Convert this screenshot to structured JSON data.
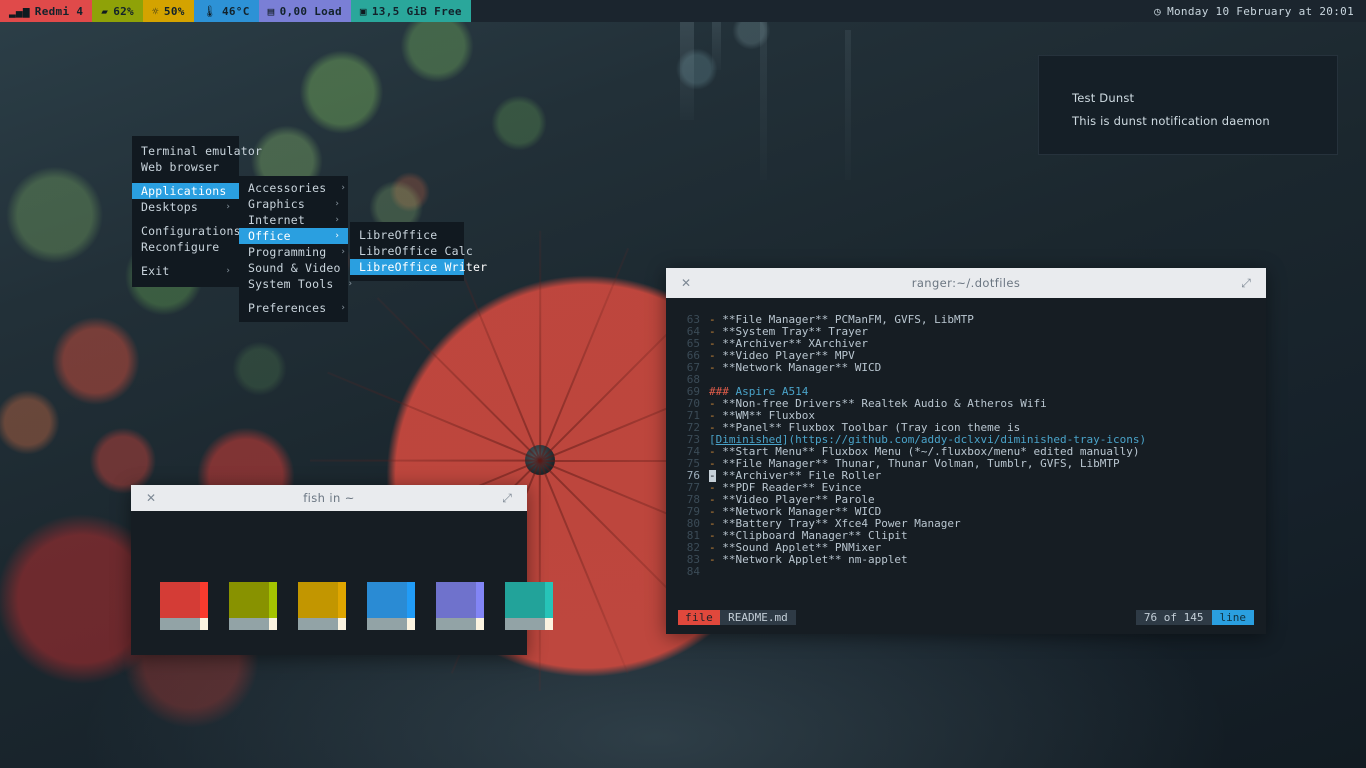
{
  "topbar": {
    "segments": [
      {
        "icon": "signal-icon",
        "glyph": "▂▄▆",
        "label": "Redmi 4",
        "bg": "#e04a4a"
      },
      {
        "icon": "battery-icon",
        "glyph": "▰",
        "label": "62%",
        "bg": "#8fa208"
      },
      {
        "icon": "brightness-icon",
        "glyph": "☼",
        "label": "50%",
        "bg": "#d4a300"
      },
      {
        "icon": "thermometer-icon",
        "glyph": "🌡",
        "label": "46°C",
        "bg": "#2d92d6"
      },
      {
        "icon": "cpu-icon",
        "glyph": "▤",
        "label": "0,00 Load",
        "bg": "#7a7fd6"
      },
      {
        "icon": "disk-icon",
        "glyph": "▣",
        "label": "13,5 GiB Free",
        "bg": "#2aa79b"
      }
    ],
    "clock": {
      "icon": "clock-icon",
      "glyph": "◷",
      "text": "Monday 10 February at 20:01"
    }
  },
  "notification": {
    "title": "Test Dunst",
    "body": "This is dunst notification daemon"
  },
  "root_menu": {
    "items": [
      {
        "label": "Terminal emulator",
        "arrow": "",
        "selected": false,
        "gap": false
      },
      {
        "label": "Web browser",
        "arrow": "",
        "selected": false,
        "gap": false
      },
      {
        "label": "Applications",
        "arrow": "›",
        "selected": true,
        "gap": true
      },
      {
        "label": "Desktops",
        "arrow": "›",
        "selected": false,
        "gap": false
      },
      {
        "label": "Configurations",
        "arrow": "",
        "selected": false,
        "gap": true
      },
      {
        "label": "Reconfigure",
        "arrow": "",
        "selected": false,
        "gap": false
      },
      {
        "label": "Exit",
        "arrow": "›",
        "selected": false,
        "gap": true
      }
    ]
  },
  "applications_menu": {
    "items": [
      {
        "label": "Accessories",
        "arrow": "›",
        "selected": false,
        "gap": false
      },
      {
        "label": "Graphics",
        "arrow": "›",
        "selected": false,
        "gap": false
      },
      {
        "label": "Internet",
        "arrow": "›",
        "selected": false,
        "gap": false
      },
      {
        "label": "Office",
        "arrow": "›",
        "selected": true,
        "gap": false
      },
      {
        "label": "Programming",
        "arrow": "›",
        "selected": false,
        "gap": false
      },
      {
        "label": "Sound & Video",
        "arrow": "›",
        "selected": false,
        "gap": false
      },
      {
        "label": "System Tools",
        "arrow": "›",
        "selected": false,
        "gap": false
      },
      {
        "label": "Preferences",
        "arrow": "›",
        "selected": false,
        "gap": true
      }
    ]
  },
  "office_menu": {
    "items": [
      {
        "label": "LibreOffice",
        "arrow": "",
        "selected": false,
        "gap": false
      },
      {
        "label": "LibreOffice Calc",
        "arrow": "",
        "selected": false,
        "gap": false
      },
      {
        "label": "LibreOffice Writer",
        "arrow": "",
        "selected": true,
        "gap": false
      }
    ]
  },
  "ranger_window": {
    "title": "ranger:~/.dotfiles",
    "close_glyph": "✕",
    "maximize_glyph": "⤢",
    "lines": [
      {
        "n": "63",
        "type": "item",
        "text": "**File Manager** PCManFM, GVFS, LibMTP"
      },
      {
        "n": "64",
        "type": "item",
        "text": "**System Tray** Trayer"
      },
      {
        "n": "65",
        "type": "item",
        "text": "**Archiver** XArchiver"
      },
      {
        "n": "66",
        "type": "item",
        "text": "**Video Player** MPV"
      },
      {
        "n": "67",
        "type": "item",
        "text": "**Network Manager** WICD"
      },
      {
        "n": "68",
        "type": "blank",
        "text": ""
      },
      {
        "n": "69",
        "type": "heading",
        "hash": "###",
        "text": "Aspire A514"
      },
      {
        "n": "70",
        "type": "item",
        "text": "**Non-free Drivers** Realtek Audio & Atheros Wifi"
      },
      {
        "n": "71",
        "type": "item",
        "text": "**WM** Fluxbox"
      },
      {
        "n": "72",
        "type": "item",
        "text": "**Panel** Fluxbox Toolbar (Tray icon theme is"
      },
      {
        "n": "73",
        "type": "link",
        "pre": "[",
        "name": "Diminished",
        "post": "](https://github.com/addy-dclxvi/diminished-tray-icons)"
      },
      {
        "n": "74",
        "type": "item",
        "text": "**Start Menu** Fluxbox Menu (*~/.fluxbox/menu* edited manually)"
      },
      {
        "n": "75",
        "type": "item",
        "text": "**File Manager** Thunar, Thunar Volman, Tumblr, GVFS, LibMTP"
      },
      {
        "n": "76",
        "type": "cursor",
        "text": "**Archiver** File Roller"
      },
      {
        "n": "77",
        "type": "item",
        "text": "**PDF Reader** Evince"
      },
      {
        "n": "78",
        "type": "item",
        "text": "**Video Player** Parole"
      },
      {
        "n": "79",
        "type": "item",
        "text": "**Network Manager** WICD"
      },
      {
        "n": "80",
        "type": "item",
        "text": "**Battery Tray** Xfce4 Power Manager"
      },
      {
        "n": "81",
        "type": "item",
        "text": "**Clipboard Manager** Clipit"
      },
      {
        "n": "82",
        "type": "item",
        "text": "**Sound Applet** PNMixer"
      },
      {
        "n": "83",
        "type": "item",
        "text": "**Network Applet** nm-applet"
      },
      {
        "n": "84",
        "type": "blank",
        "text": ""
      }
    ],
    "status": {
      "file_label": "file",
      "file_name": "README.md",
      "position": "76 of 145",
      "unit": "line"
    }
  },
  "fish_window": {
    "title": "fish in ~",
    "close_glyph": "✕",
    "maximize_glyph": "⤢",
    "palette": [
      {
        "name": "red",
        "main": "#d43c36",
        "bright": "#f93b2e"
      },
      {
        "name": "green",
        "main": "#889200",
        "bright": "#a4c400"
      },
      {
        "name": "yellow",
        "main": "#c29600",
        "bright": "#e0a600"
      },
      {
        "name": "blue",
        "main": "#2a8bd4",
        "bright": "#219cf7"
      },
      {
        "name": "magenta",
        "main": "#6f72cc",
        "bright": "#8285f5"
      },
      {
        "name": "cyan",
        "main": "#22a39a",
        "bright": "#27c4b8"
      }
    ],
    "fg": "#92a3a6",
    "white": "#fbf3e0"
  }
}
